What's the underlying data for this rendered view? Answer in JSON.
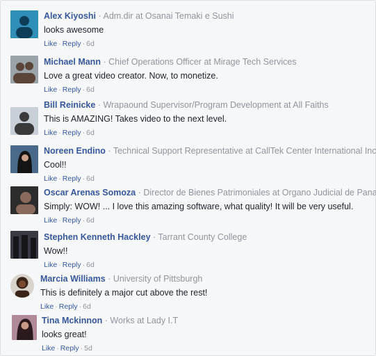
{
  "separator": "·",
  "comments": [
    {
      "name": "Alex Kiyoshi",
      "title": "Adm.dir at Osanai Temaki e Sushi",
      "text": "looks awesome",
      "like": "Like",
      "reply": "Reply",
      "age": "6d",
      "avatar_bg": "#2f8fb8",
      "avatar_fg": "#0e3d58"
    },
    {
      "name": "Michael Mann",
      "title": "Chief Operations Officer at Mirage Tech Services",
      "text": "Love a great video creator. Now, to monetize.",
      "like": "Like",
      "reply": "Reply",
      "age": "6d",
      "avatar_bg": "#9aa3a8",
      "avatar_fg": "#5a4538"
    },
    {
      "name": "Bill Reinicke",
      "title": "Wrapaound Supervisor/Program Development at All Faiths",
      "text": "This is AMAZING! Takes video to the next level.",
      "like": "Like",
      "reply": "Reply",
      "age": "6d",
      "avatar_bg": "#c8cfd6",
      "avatar_fg": "#3a3a3a"
    },
    {
      "name": "Noreen Endino",
      "title": "Technical Support Representative at CallTek Center International Inc.",
      "text": "Cool!!",
      "like": "Like",
      "reply": "Reply",
      "age": "6d",
      "avatar_bg": "#4a6a8a",
      "avatar_fg": "#141414"
    },
    {
      "name": "Oscar Arenas Somoza",
      "title": "Director de Bienes Patrimoniales at Organo Judicial de Panamá",
      "text": "Simply: WOW! ... I love this amazing software, what quality! It will be very useful.",
      "like": "Like",
      "reply": "Reply",
      "age": "6d",
      "avatar_bg": "#2c2c2c",
      "avatar_fg": "#8a6a5a"
    },
    {
      "name": "Stephen Kenneth Hackley",
      "title": "Tarrant County College",
      "text": "Wow!!",
      "like": "Like",
      "reply": "Reply",
      "age": "6d",
      "avatar_bg": "#3a3a44",
      "avatar_fg": "#15151a"
    },
    {
      "name": "Marcia Williams",
      "title": "University of Pittsburgh",
      "text": "This is definitely a major cut above the rest!",
      "like": "Like",
      "reply": "Reply",
      "age": "6d",
      "avatar_bg": "#d8d4cc",
      "avatar_fg": "#3b2418"
    },
    {
      "name": "Tina Mckinnon",
      "title": "Works at Lady I.T",
      "text": "looks great!",
      "like": "Like",
      "reply": "Reply",
      "age": "5d",
      "avatar_bg": "#b08a98",
      "avatar_fg": "#2a1a1e"
    }
  ]
}
